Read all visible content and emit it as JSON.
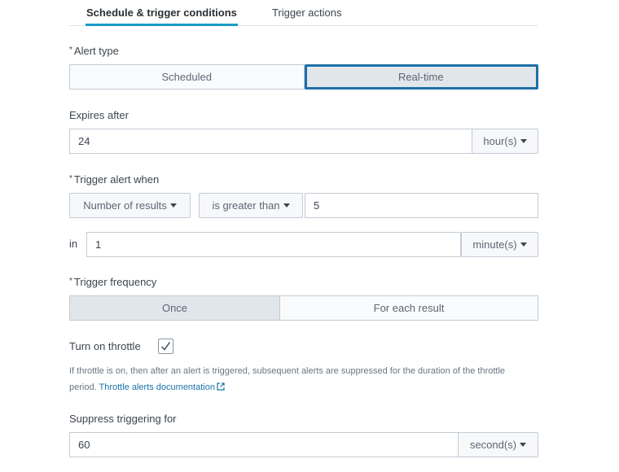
{
  "tabs": [
    {
      "label": "Schedule & trigger conditions",
      "active": true
    },
    {
      "label": "Trigger actions",
      "active": false
    }
  ],
  "alert_type": {
    "required_marker": "*",
    "label": "Alert type",
    "options": [
      "Scheduled",
      "Real-time"
    ],
    "selected": "Real-time"
  },
  "expires": {
    "label": "Expires after",
    "value": "24",
    "unit": "hour(s)"
  },
  "trigger_when": {
    "required_marker": "*",
    "label": "Trigger alert when",
    "condition": "Number of results",
    "comparison": "is greater than",
    "value": "5",
    "in_label": "in",
    "window_value": "1",
    "window_unit": "minute(s)"
  },
  "trigger_frequency": {
    "required_marker": "*",
    "label": "Trigger frequency",
    "options": [
      "Once",
      "For each result"
    ],
    "selected": "Once"
  },
  "throttle": {
    "label": "Turn on throttle",
    "checked": true,
    "help_text": "If throttle is on, then after an alert is triggered, subsequent alerts are suppressed for the duration of the throttle period.",
    "doc_link": "Throttle alerts documentation"
  },
  "suppress": {
    "label": "Suppress triggering for",
    "value": "60",
    "unit": "second(s)"
  },
  "colors": {
    "active_tab_underline": "#1a9bc7",
    "focus_ring": "#1f6fa8",
    "link": "#1a73a8"
  }
}
